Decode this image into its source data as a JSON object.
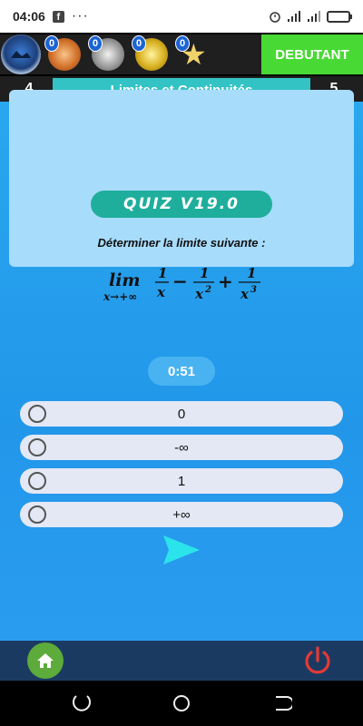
{
  "status_bar": {
    "time": "04:06",
    "facebook_icon": "facebook-notification-icon",
    "more_icon": "three-dots-icon",
    "dots": "···"
  },
  "header": {
    "medals": [
      {
        "type": "bronze",
        "count": "0"
      },
      {
        "type": "silver",
        "count": "0"
      },
      {
        "type": "gold",
        "count": "0"
      },
      {
        "type": "star",
        "count": "0"
      }
    ],
    "level_label": "DEBUTANT",
    "level_color": "#49d935"
  },
  "chapter": {
    "left_number": "4",
    "title": "Limites et Continuités",
    "right_number": "5",
    "title_color": "#33c3c5"
  },
  "quiz": {
    "badge": "QUIZ V19.0",
    "question": "Déterminer la limite suivante :",
    "formula": {
      "lim": "lim",
      "subscript": "x→+∞",
      "num1": "1",
      "den1": "x",
      "op1": "−",
      "num2": "1",
      "den2": "x",
      "exp2": "2",
      "op2": "+",
      "num3": "1",
      "den3": "x",
      "exp3": "3"
    },
    "timer": "0:51",
    "options": [
      "0",
      "-∞",
      "1",
      "+∞"
    ]
  },
  "bottom_bar": {
    "home_icon": "home-icon",
    "power_icon": "power-icon",
    "home_color": "#5cab3b",
    "power_color": "#e53935"
  },
  "nav_bar": {
    "back_icon": "back-icon",
    "home_icon": "circle-home-icon",
    "recent_icon": "recent-apps-icon"
  }
}
